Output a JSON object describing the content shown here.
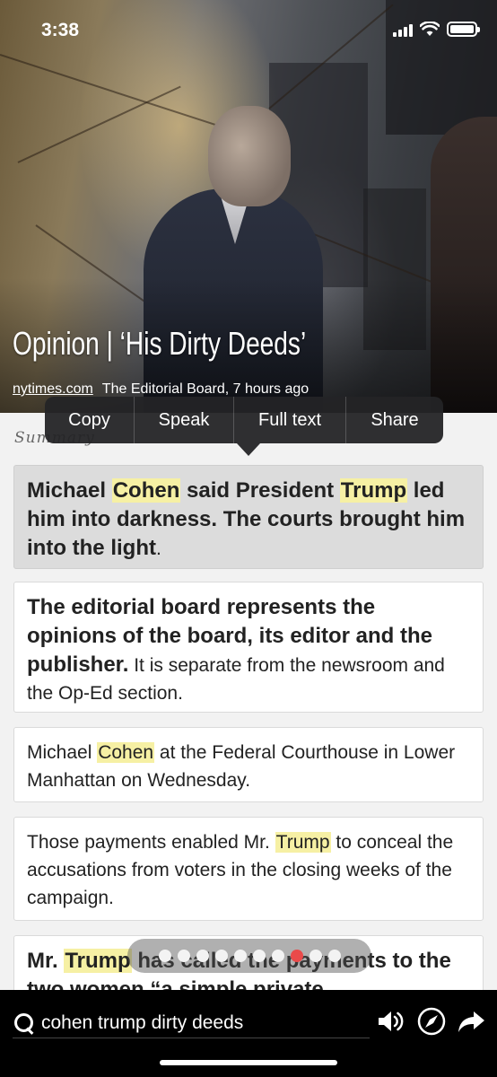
{
  "status_bar": {
    "time": "3:38"
  },
  "article": {
    "headline": "Opinion | ‘His Dirty Deeds’",
    "source": "nytimes.com",
    "byline": "The Editorial Board, 7 hours ago",
    "summary_label": "Summary"
  },
  "context_menu": {
    "items": [
      "Copy",
      "Speak",
      "Full text",
      "Share"
    ]
  },
  "cards": [
    {
      "segments": [
        {
          "text": "Michael ",
          "bold": true
        },
        {
          "text": "Cohen",
          "bold": true,
          "hl": true
        },
        {
          "text": " said President ",
          "bold": true
        },
        {
          "text": "Trump",
          "bold": true,
          "hl": true
        },
        {
          "text": " led him into darkness. The courts brought him into the light",
          "bold": true
        },
        {
          "text": "."
        }
      ]
    },
    {
      "segments": [
        {
          "text": "The editorial board represents the opinions of the board, its editor and the publisher.",
          "bold": true
        },
        {
          "text": " It is separate from the newsroom and the Op-Ed section."
        }
      ]
    },
    {
      "segments": [
        {
          "text": "Michael "
        },
        {
          "text": "Cohen",
          "hl": true
        },
        {
          "text": " at the Federal Courthouse in Lower Manhattan on Wednesday."
        }
      ]
    },
    {
      "segments": [
        {
          "text": "Those payments enabled Mr. "
        },
        {
          "text": "Trump",
          "hl": true
        },
        {
          "text": " to conceal the accusations from voters in the closing weeks of the campaign."
        }
      ]
    },
    {
      "segments": [
        {
          "text": "Mr. ",
          "bold": true
        },
        {
          "text": "Trump",
          "bold": true,
          "hl": true
        },
        {
          "text": " has called the payments to the two women “a simple private",
          "bold": true
        }
      ]
    }
  ],
  "page_dots": {
    "count": 10,
    "active_index": 7
  },
  "bottom_bar": {
    "search_query": "cohen trump dirty deeds",
    "icons": [
      "speaker-icon",
      "compass-icon",
      "share-arrow-icon"
    ]
  }
}
